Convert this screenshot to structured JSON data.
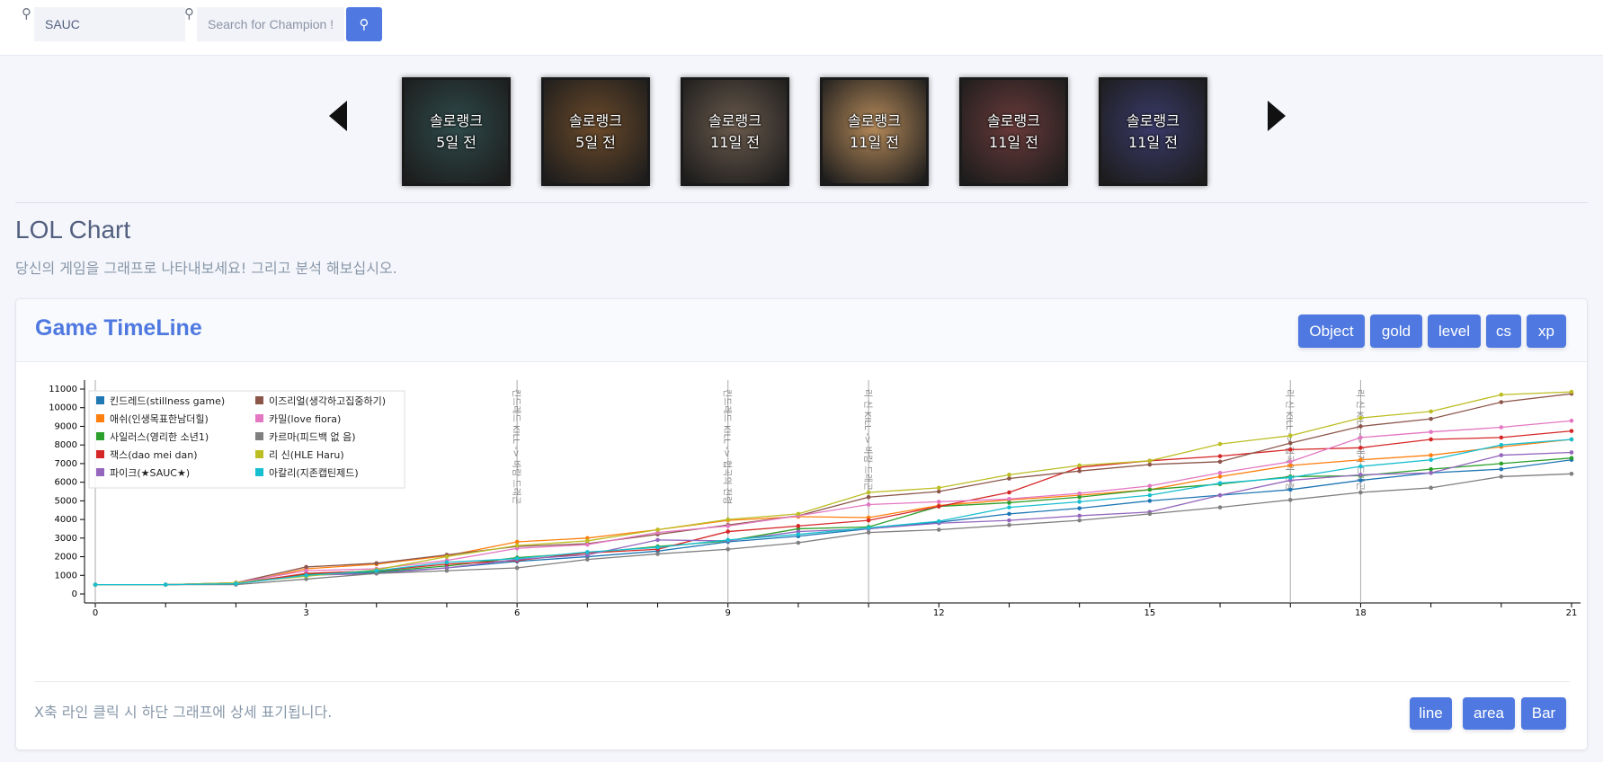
{
  "search": {
    "summoner_value": "SAUC",
    "champion_placeholder": "Search for Champion !",
    "search_icon": "magnifier-icon"
  },
  "carousel": {
    "items": [
      {
        "line1": "솔로랭크",
        "line2": "5일 전",
        "bg": "#2f4a4a"
      },
      {
        "line1": "솔로랭크",
        "line2": "5일 전",
        "bg": "#6b4a2a"
      },
      {
        "line1": "솔로랭크",
        "line2": "11일 전",
        "bg": "#6a5a4c"
      },
      {
        "line1": "솔로랭크",
        "line2": "11일 전",
        "bg": "#b58a5a"
      },
      {
        "line1": "솔로랭크",
        "line2": "11일 전",
        "bg": "#6a3a3a"
      },
      {
        "line1": "솔로랭크",
        "line2": "11일 전",
        "bg": "#3a3a6a"
      }
    ]
  },
  "page": {
    "title": "LOL Chart",
    "subtitle": "당신의 게임을 그래프로 나타내보세요! 그리고 분석 해보십시오."
  },
  "card": {
    "title": "Game TimeLine",
    "buttons": [
      "Object",
      "gold",
      "level",
      "cs",
      "xp"
    ],
    "footer_note": "X축 라인 클릭 시 하단 그래프에 상세 표기됩니다.",
    "chart_buttons": [
      "line",
      "area",
      "Bar"
    ]
  },
  "chart_data": {
    "type": "line",
    "x": [
      0,
      1,
      2,
      3,
      4,
      5,
      6,
      7,
      8,
      9,
      10,
      11,
      12,
      13,
      14,
      15,
      16,
      17,
      18,
      19,
      20,
      21
    ],
    "xticks": [
      0,
      3,
      6,
      9,
      12,
      15,
      18,
      21
    ],
    "ylim": [
      0,
      11000
    ],
    "yticks": [
      0,
      1000,
      2000,
      3000,
      4000,
      5000,
      6000,
      7000,
      8000,
      9000,
      10000,
      11000
    ],
    "legend_position": "top-left",
    "series": [
      {
        "name": "킨드레드(stillness game)",
        "color": "#1f77b4",
        "values": [
          500,
          500,
          550,
          1000,
          1150,
          1400,
          1750,
          2000,
          2300,
          2800,
          3100,
          3500,
          3850,
          4300,
          4600,
          5000,
          5300,
          5600,
          6100,
          6500,
          6700,
          7200
        ]
      },
      {
        "name": "애쉬(인생목표한남더힐)",
        "color": "#ff7f0e",
        "values": [
          500,
          500,
          550,
          1350,
          1600,
          2050,
          2800,
          3000,
          3450,
          3950,
          4150,
          4100,
          4750,
          5050,
          5300,
          5600,
          6300,
          6900,
          7200,
          7450,
          7900,
          8300
        ]
      },
      {
        "name": "사일러스(영리한 소년1)",
        "color": "#2ca02c",
        "values": [
          500,
          500,
          600,
          1050,
          1200,
          1500,
          1950,
          2200,
          2550,
          2850,
          3500,
          3600,
          4700,
          4900,
          5200,
          5600,
          5900,
          6300,
          6350,
          6700,
          7000,
          7300
        ]
      },
      {
        "name": "잭스(dao mei dan)",
        "color": "#d62728",
        "values": [
          500,
          500,
          550,
          1100,
          1250,
          1600,
          1800,
          2200,
          2400,
          3350,
          3650,
          3950,
          4700,
          5450,
          6800,
          7150,
          7400,
          7750,
          7850,
          8300,
          8400,
          8750
        ]
      },
      {
        "name": "파이크(★SAUC★)",
        "color": "#9467bd",
        "values": [
          500,
          500,
          550,
          1000,
          1100,
          1400,
          1850,
          2100,
          2900,
          2850,
          3350,
          3500,
          3800,
          3950,
          4200,
          4400,
          5300,
          6100,
          6400,
          6500,
          7450,
          7600
        ]
      },
      {
        "name": "이즈리얼(생각하고집중하기)",
        "color": "#8c564b",
        "values": [
          500,
          500,
          600,
          1450,
          1650,
          2100,
          2550,
          2700,
          3200,
          3700,
          4200,
          5200,
          5500,
          6200,
          6600,
          6950,
          7100,
          8100,
          9000,
          9400,
          10300,
          10750
        ]
      },
      {
        "name": "카밀(love fiora)",
        "color": "#e377c2",
        "values": [
          500,
          500,
          600,
          1250,
          1350,
          1800,
          2450,
          2650,
          3300,
          3650,
          4200,
          4800,
          4950,
          5100,
          5400,
          5800,
          6500,
          7100,
          8400,
          8700,
          8950,
          9300
        ]
      },
      {
        "name": "카르마(피드백 없 음)",
        "color": "#7f7f7f",
        "values": [
          500,
          500,
          500,
          800,
          1100,
          1250,
          1400,
          1850,
          2150,
          2400,
          2750,
          3300,
          3450,
          3700,
          3950,
          4300,
          4650,
          5050,
          5450,
          5700,
          6300,
          6450
        ]
      },
      {
        "name": "리 신(HLE Haru)",
        "color": "#bcbd22",
        "values": [
          500,
          500,
          600,
          950,
          1300,
          2000,
          2600,
          2850,
          3450,
          4000,
          4300,
          5450,
          5700,
          6400,
          6900,
          7150,
          8050,
          8500,
          9450,
          9800,
          10700,
          10850
        ]
      },
      {
        "name": "아칼리(지존캡틴제드)",
        "color": "#17becf",
        "values": [
          500,
          500,
          550,
          1000,
          1250,
          1700,
          1900,
          2250,
          2500,
          2900,
          3200,
          3550,
          3900,
          4650,
          4950,
          5300,
          5950,
          6250,
          6850,
          7200,
          8000,
          8300
        ]
      }
    ],
    "event_lines": [
      {
        "x": 0,
        "label": ""
      },
      {
        "x": 6,
        "label": "킨드레드 KILL -> 바람 드래곤"
      },
      {
        "x": 9,
        "label": "킨드레드 KILL -> 협곡의 전령"
      },
      {
        "x": 11,
        "label": "리 신 KILL -> 바람 드래곤"
      },
      {
        "x": 17,
        "label": "리 신 KILL -> 협곡의 전령"
      },
      {
        "x": 18,
        "label": "리 신 KILL -> 대지 드래곤"
      }
    ]
  }
}
